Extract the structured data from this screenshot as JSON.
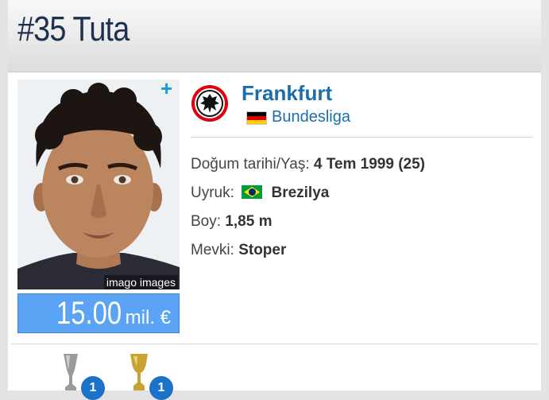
{
  "header": {
    "title": "#35 Tuta"
  },
  "player": {
    "photo_credit": "imago images",
    "market_value_number": "15.00",
    "market_value_unit": "mil. €"
  },
  "club": {
    "name": "Frankfurt",
    "league": "Bundesliga",
    "league_flag": "germany-flag"
  },
  "info": {
    "birth": {
      "label": "Doğum tarihi/Yaş:",
      "value": "4 Tem 1999 (25)"
    },
    "nationality": {
      "label": "Uyruk:",
      "value": "Brezilya",
      "flag": "brazil-flag"
    },
    "height": {
      "label": "Boy:",
      "value": "1,85 m"
    },
    "position": {
      "label": "Mevki:",
      "value": "Stoper"
    }
  },
  "trophies": [
    {
      "icon": "trophy-cup-icon",
      "count": "1"
    },
    {
      "icon": "trophy-gold-icon",
      "count": "1"
    }
  ],
  "colors": {
    "header_text": "#1d3050",
    "link": "#1b6ea8",
    "value_bg": "#5aa3f5",
    "badge": "#1a72c9"
  }
}
